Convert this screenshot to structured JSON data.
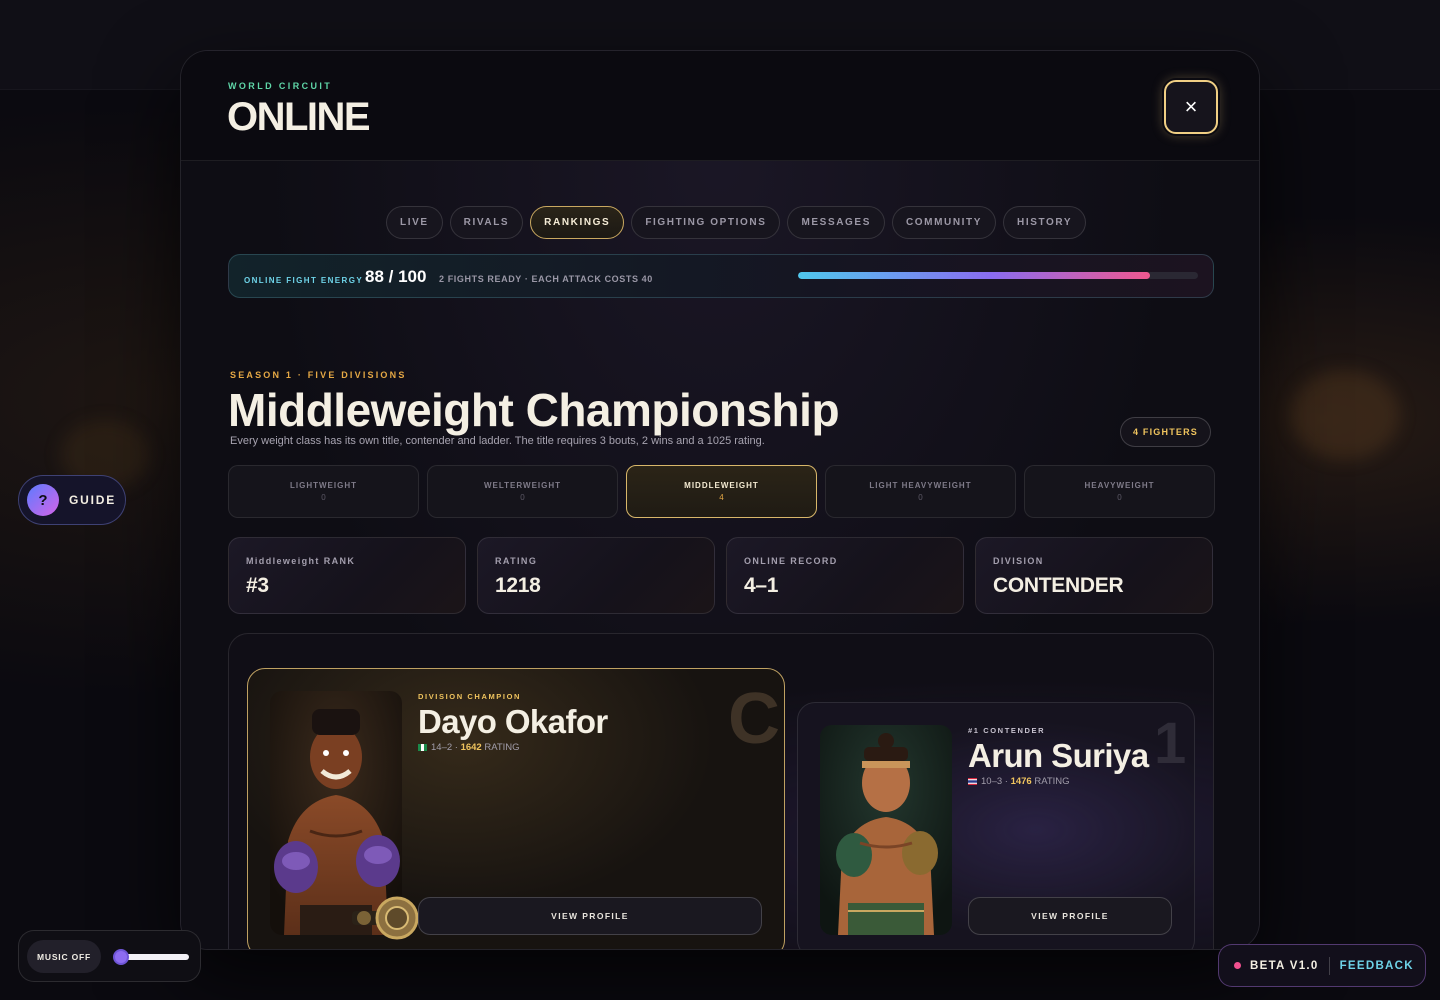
{
  "modal": {
    "eyebrow": "WORLD CIRCUIT",
    "title": "ONLINE",
    "close_label": "×"
  },
  "tabs": [
    {
      "label": "LIVE",
      "active": false
    },
    {
      "label": "RIVALS",
      "active": false
    },
    {
      "label": "RANKINGS",
      "active": true
    },
    {
      "label": "FIGHTING OPTIONS",
      "active": false
    },
    {
      "label": "MESSAGES",
      "active": false
    },
    {
      "label": "COMMUNITY",
      "active": false
    },
    {
      "label": "HISTORY",
      "active": false
    }
  ],
  "energy": {
    "label": "ONLINE FIGHT ENERGY",
    "value": "88 / 100",
    "current": 88,
    "max": 100,
    "note": "2 FIGHTS READY · EACH ATTACK COSTS 40"
  },
  "championship": {
    "season": "SEASON 1 · FIVE DIVISIONS",
    "title": "Middleweight Championship",
    "description": "Every weight class has its own title, contender and ladder. The title requires 3 bouts, 2 wins and a 1025 rating.",
    "fighters_badge": "4 FIGHTERS"
  },
  "divisions": [
    {
      "name": "LIGHTWEIGHT",
      "count": "0",
      "active": false
    },
    {
      "name": "WELTERWEIGHT",
      "count": "0",
      "active": false
    },
    {
      "name": "MIDDLEWEIGHT",
      "count": "4",
      "active": true
    },
    {
      "name": "LIGHT HEAVYWEIGHT",
      "count": "0",
      "active": false
    },
    {
      "name": "HEAVYWEIGHT",
      "count": "0",
      "active": false
    }
  ],
  "stats": [
    {
      "label": "Middleweight RANK",
      "value": "#3"
    },
    {
      "label": "RATING",
      "value": "1218"
    },
    {
      "label": "ONLINE RECORD",
      "value": "4–1"
    },
    {
      "label": "DIVISION",
      "value": "CONTENDER"
    }
  ],
  "champion": {
    "eyebrow": "DIVISION CHAMPION",
    "name": "Dayo Okafor",
    "record": "14–2 · ",
    "rating": "1642",
    "rating_label": " RATING",
    "rank_mark": "C",
    "button": "VIEW PROFILE",
    "flag": "nigeria-flag-icon"
  },
  "contender": {
    "eyebrow": "#1 CONTENDER",
    "name": "Arun Suriya",
    "record": "10–3 · ",
    "rating": "1476",
    "rating_label": " RATING",
    "rank_mark": "1",
    "button": "VIEW PROFILE",
    "flag": "thailand-flag-icon"
  },
  "guide": {
    "icon_text": "?",
    "label": "GUIDE"
  },
  "music": {
    "label": "MUSIC OFF",
    "volume": 0
  },
  "beta": {
    "label": "BETA V1.0",
    "link": "FEEDBACK"
  },
  "colors": {
    "gold": "#e5a845",
    "accent_green": "#5fd6a8",
    "energy_cyan": "#6ed3e8",
    "energy_pink": "#f0588f"
  }
}
